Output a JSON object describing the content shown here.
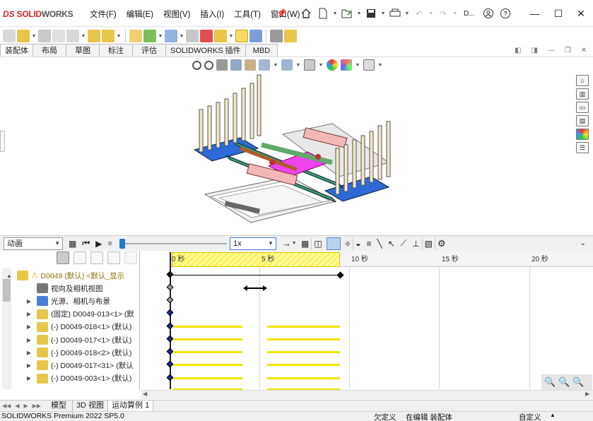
{
  "app": {
    "logo_ds": "DS",
    "logo_solid": "SOLID",
    "logo_works": "WORKS",
    "pin_icon": "pin-icon"
  },
  "menu": [
    "文件(F)",
    "编辑(E)",
    "视图(V)",
    "插入(I)",
    "工具(T)",
    "窗口(W)"
  ],
  "quick_toolbar": {
    "icons": [
      "home-icon",
      "new-document-icon",
      "open-folder-icon",
      "save-icon",
      "print-icon",
      "undo-icon",
      "redo-icon"
    ],
    "overflow_label": "D...",
    "search_icon": "search-user-icon"
  },
  "command_tabs": [
    "装配体",
    "布局",
    "草图",
    "标注",
    "评估",
    "SOLIDWORKS 插件",
    "MBD"
  ],
  "view_toolbar_icons": [
    "zoom-to-fit-icon",
    "zoom-area-icon",
    "previous-view-icon",
    "section-view-icon",
    "dynamic-annotation-icon",
    "view-orientation-icon",
    "display-style-icon",
    "hide-show-icon",
    "edit-appearance-icon",
    "apply-scene-icon",
    "view-settings-icon"
  ],
  "right_dock_icons": [
    "home-dock-icon",
    "parts-library-icon",
    "file-explorer-icon",
    "view-palette-icon",
    "appearances-icon",
    "custom-properties-icon"
  ],
  "motion": {
    "study_type": "动画",
    "playback_speed": "1x",
    "timeline_ticks": [
      "0 秒",
      "5 秒",
      "10 秒",
      "15 秒",
      "20 秒"
    ]
  },
  "tree": {
    "rows": [
      {
        "label": "D0049 (默认) <默认_显示",
        "expander": "▲",
        "warning": true
      },
      {
        "label": "视向及相机视图",
        "expander": ""
      },
      {
        "label": "光源、相机与布景",
        "expander": "▶"
      },
      {
        "label": "(固定) D0049-013<1> (默",
        "expander": "▶"
      },
      {
        "label": "(-) D0049-018<1> (默认)",
        "expander": "▶"
      },
      {
        "label": "(-) D0049-017<1> (默认)",
        "expander": "▶"
      },
      {
        "label": "(-) D0049-018<2> (默认)",
        "expander": "▶"
      },
      {
        "label": "(-) D0049-017<31> (默认",
        "expander": "▶"
      },
      {
        "label": "(-) D0049-003<1> (默认)",
        "expander": "▶"
      }
    ]
  },
  "bottom_tabs": [
    "模型",
    "3D 视图",
    "运动算例 1"
  ],
  "status": {
    "product": "SOLIDWORKS Premium 2022 SP5.0",
    "under_defined": "欠定义",
    "editing": "在编辑 装配体",
    "custom": "自定义"
  },
  "colors": {
    "accent_red": "#d2232a",
    "timeline_yellow": "#f0e400",
    "key_blue": "#1a2a8c"
  }
}
